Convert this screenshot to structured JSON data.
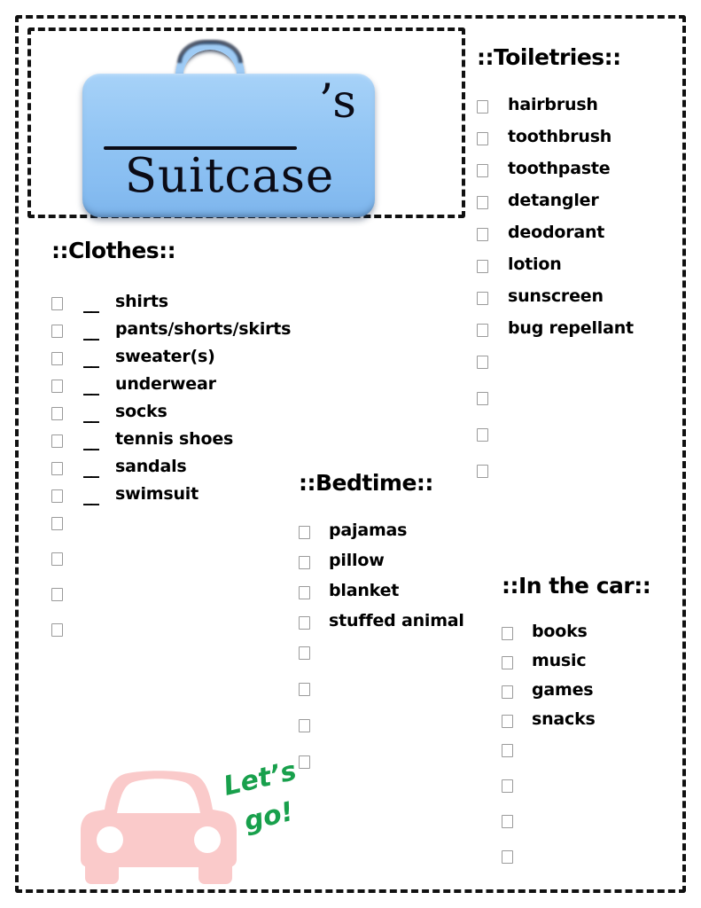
{
  "page": {
    "title_word": "Suitcase",
    "apostrophe_s": "’s",
    "name_blank_label": "name-blank-line"
  },
  "colors": {
    "suitcase_blue": "#92c5f4",
    "car_pink": "#facaca",
    "lets_go_green": "#18a04c",
    "ink": "#000000",
    "checkbox_border": "#9a9a9a"
  },
  "blank_line_text": "__________",
  "quantity_blank": "__",
  "sections": {
    "clothes": {
      "title": "::Clothes::",
      "items": [
        {
          "qty": "__",
          "label": "shirts"
        },
        {
          "qty": "__",
          "label": "pants/shorts/skirts"
        },
        {
          "qty": "__",
          "label": "sweater(s)"
        },
        {
          "qty": "__",
          "label": "underwear"
        },
        {
          "qty": "__",
          "label": "socks"
        },
        {
          "qty": "__",
          "label": "tennis shoes"
        },
        {
          "qty": "__",
          "label": "sandals"
        },
        {
          "qty": "__",
          "label": "swimsuit"
        }
      ],
      "blank_count": 4
    },
    "toiletries": {
      "title": "::Toiletries::",
      "items": [
        {
          "qty": "",
          "label": "hairbrush"
        },
        {
          "qty": "",
          "label": "toothbrush"
        },
        {
          "qty": "",
          "label": "toothpaste"
        },
        {
          "qty": "",
          "label": "detangler"
        },
        {
          "qty": "",
          "label": "deodorant"
        },
        {
          "qty": "",
          "label": "lotion"
        },
        {
          "qty": "",
          "label": "sunscreen"
        },
        {
          "qty": "",
          "label": "bug repellant"
        }
      ],
      "blank_count": 4
    },
    "bedtime": {
      "title": "::Bedtime::",
      "items": [
        {
          "qty": "",
          "label": "pajamas"
        },
        {
          "qty": "",
          "label": "pillow"
        },
        {
          "qty": "",
          "label": "blanket"
        },
        {
          "qty": "",
          "label": "stuffed animal"
        }
      ],
      "blank_count": 4
    },
    "car": {
      "title": "::In the car::",
      "items": [
        {
          "qty": "",
          "label": "books"
        },
        {
          "qty": "",
          "label": "music"
        },
        {
          "qty": "",
          "label": "games"
        },
        {
          "qty": "",
          "label": "snacks"
        }
      ],
      "blank_count": 4
    }
  },
  "decorations": {
    "lets_go_line1": "Let’s",
    "lets_go_line2": "go!"
  }
}
